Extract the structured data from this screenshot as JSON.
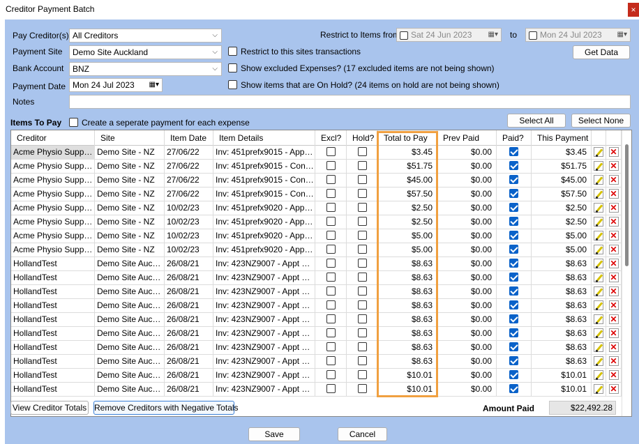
{
  "window": {
    "title": "Creditor Payment Batch",
    "close_icon": "close-icon"
  },
  "form": {
    "pay_creditors_label": "Pay Creditor(s)",
    "pay_creditors_value": "All Creditors",
    "payment_site_label": "Payment Site",
    "payment_site_value": "Demo Site Auckland",
    "bank_account_label": "Bank Account",
    "bank_account_value": "BNZ",
    "payment_date_label": "Payment Date",
    "payment_date_value": "Mon 24 Jul  2023",
    "notes_label": "Notes",
    "notes_value": "",
    "restrict_label": "Restrict to Items from",
    "restrict_from": "Sat  24 Jun  2023",
    "to_label": "to",
    "restrict_to": "Mon 24  Jul  2023",
    "get_data_label": "Get Data",
    "restrict_site_label": "Restrict to this sites transactions",
    "show_excluded_label": "Show excluded Expenses? (17 excluded items are not being shown)",
    "show_onhold_label": "Show items that are On Hold? (24 items on hold are not being shown)"
  },
  "items": {
    "heading": "Items To Pay",
    "separate_payment_label": "Create a seperate payment for each expense",
    "select_all_label": "Select All",
    "select_none_label": "Select None"
  },
  "table": {
    "headers": [
      "Creditor",
      "Site",
      "Item Date",
      "Item Details",
      "Excl?",
      "Hold?",
      "Total to Pay",
      "Prev Paid",
      "Paid?",
      "This Payment"
    ],
    "rows": [
      {
        "creditor": "Acme Physio Supplie...",
        "site": "Demo Site - NZ",
        "date": "27/06/22",
        "details": "Inv: 451prefx9015 - Appt S...",
        "excl": false,
        "hold": false,
        "total": "$3.45",
        "prev": "$0.00",
        "paid": true,
        "payment": "$3.45"
      },
      {
        "creditor": "Acme Physio Supplie...",
        "site": "Demo Site - NZ",
        "date": "27/06/22",
        "details": "Inv: 451prefx9015 - Contra...",
        "excl": false,
        "hold": false,
        "total": "$51.75",
        "prev": "$0.00",
        "paid": true,
        "payment": "$51.75"
      },
      {
        "creditor": "Acme Physio Supplie...",
        "site": "Demo Site - NZ",
        "date": "27/06/22",
        "details": "Inv: 451prefx9015 - Contra...",
        "excl": false,
        "hold": false,
        "total": "$45.00",
        "prev": "$0.00",
        "paid": true,
        "payment": "$45.00"
      },
      {
        "creditor": "Acme Physio Supplie...",
        "site": "Demo Site - NZ",
        "date": "27/06/22",
        "details": "Inv: 451prefx9015 - Contra...",
        "excl": false,
        "hold": false,
        "total": "$57.50",
        "prev": "$0.00",
        "paid": true,
        "payment": "$57.50"
      },
      {
        "creditor": "Acme Physio Supplie...",
        "site": "Demo Site - NZ",
        "date": "10/02/23",
        "details": "Inv: 451prefx9020 - Appt S...",
        "excl": false,
        "hold": false,
        "total": "$2.50",
        "prev": "$0.00",
        "paid": true,
        "payment": "$2.50"
      },
      {
        "creditor": "Acme Physio Supplie...",
        "site": "Demo Site - NZ",
        "date": "10/02/23",
        "details": "Inv: 451prefx9020 - Appt S...",
        "excl": false,
        "hold": false,
        "total": "$2.50",
        "prev": "$0.00",
        "paid": true,
        "payment": "$2.50"
      },
      {
        "creditor": "Acme Physio Supplie...",
        "site": "Demo Site - NZ",
        "date": "10/02/23",
        "details": "Inv: 451prefx9020 - Appt S...",
        "excl": false,
        "hold": false,
        "total": "$5.00",
        "prev": "$0.00",
        "paid": true,
        "payment": "$5.00"
      },
      {
        "creditor": "Acme Physio Supplie...",
        "site": "Demo Site - NZ",
        "date": "10/02/23",
        "details": "Inv: 451prefx9020 - Appt S...",
        "excl": false,
        "hold": false,
        "total": "$5.00",
        "prev": "$0.00",
        "paid": true,
        "payment": "$5.00"
      },
      {
        "creditor": "HollandTest",
        "site": "Demo Site Auckl...",
        "date": "26/08/21",
        "details": "Inv: 423NZ9007 - Appt Ser...",
        "excl": false,
        "hold": false,
        "total": "$8.63",
        "prev": "$0.00",
        "paid": true,
        "payment": "$8.63"
      },
      {
        "creditor": "HollandTest",
        "site": "Demo Site Auckl...",
        "date": "26/08/21",
        "details": "Inv: 423NZ9007 - Appt Ser...",
        "excl": false,
        "hold": false,
        "total": "$8.63",
        "prev": "$0.00",
        "paid": true,
        "payment": "$8.63"
      },
      {
        "creditor": "HollandTest",
        "site": "Demo Site Auckl...",
        "date": "26/08/21",
        "details": "Inv: 423NZ9007 - Appt Ser...",
        "excl": false,
        "hold": false,
        "total": "$8.63",
        "prev": "$0.00",
        "paid": true,
        "payment": "$8.63"
      },
      {
        "creditor": "HollandTest",
        "site": "Demo Site Auckl...",
        "date": "26/08/21",
        "details": "Inv: 423NZ9007 - Appt Ser...",
        "excl": false,
        "hold": false,
        "total": "$8.63",
        "prev": "$0.00",
        "paid": true,
        "payment": "$8.63"
      },
      {
        "creditor": "HollandTest",
        "site": "Demo Site Auckl...",
        "date": "26/08/21",
        "details": "Inv: 423NZ9007 - Appt Ser...",
        "excl": false,
        "hold": false,
        "total": "$8.63",
        "prev": "$0.00",
        "paid": true,
        "payment": "$8.63"
      },
      {
        "creditor": "HollandTest",
        "site": "Demo Site Auckl...",
        "date": "26/08/21",
        "details": "Inv: 423NZ9007 - Appt Ser...",
        "excl": false,
        "hold": false,
        "total": "$8.63",
        "prev": "$0.00",
        "paid": true,
        "payment": "$8.63"
      },
      {
        "creditor": "HollandTest",
        "site": "Demo Site Auckl...",
        "date": "26/08/21",
        "details": "Inv: 423NZ9007 - Appt Ser...",
        "excl": false,
        "hold": false,
        "total": "$8.63",
        "prev": "$0.00",
        "paid": true,
        "payment": "$8.63"
      },
      {
        "creditor": "HollandTest",
        "site": "Demo Site Auckl...",
        "date": "26/08/21",
        "details": "Inv: 423NZ9007 - Appt Ser...",
        "excl": false,
        "hold": false,
        "total": "$8.63",
        "prev": "$0.00",
        "paid": true,
        "payment": "$8.63"
      },
      {
        "creditor": "HollandTest",
        "site": "Demo Site Auckl...",
        "date": "26/08/21",
        "details": "Inv: 423NZ9007 - Appt Ser...",
        "excl": false,
        "hold": false,
        "total": "$10.01",
        "prev": "$0.00",
        "paid": true,
        "payment": "$10.01"
      },
      {
        "creditor": "HollandTest",
        "site": "Demo Site Auckl...",
        "date": "26/08/21",
        "details": "Inv: 423NZ9007 - Appt Ser...",
        "excl": false,
        "hold": false,
        "total": "$10.01",
        "prev": "$0.00",
        "paid": true,
        "payment": "$10.01"
      }
    ]
  },
  "footer": {
    "view_totals_label": "View Creditor Totals",
    "remove_negative_label": "Remove Creditors with Negative Totals",
    "amount_paid_label": "Amount Paid",
    "amount_paid_value": "$22,492.28",
    "save_label": "Save",
    "cancel_label": "Cancel"
  },
  "colors": {
    "client_bg": "#a9c4ed",
    "highlight": "#f0a040",
    "check_blue": "#0a62c9"
  }
}
